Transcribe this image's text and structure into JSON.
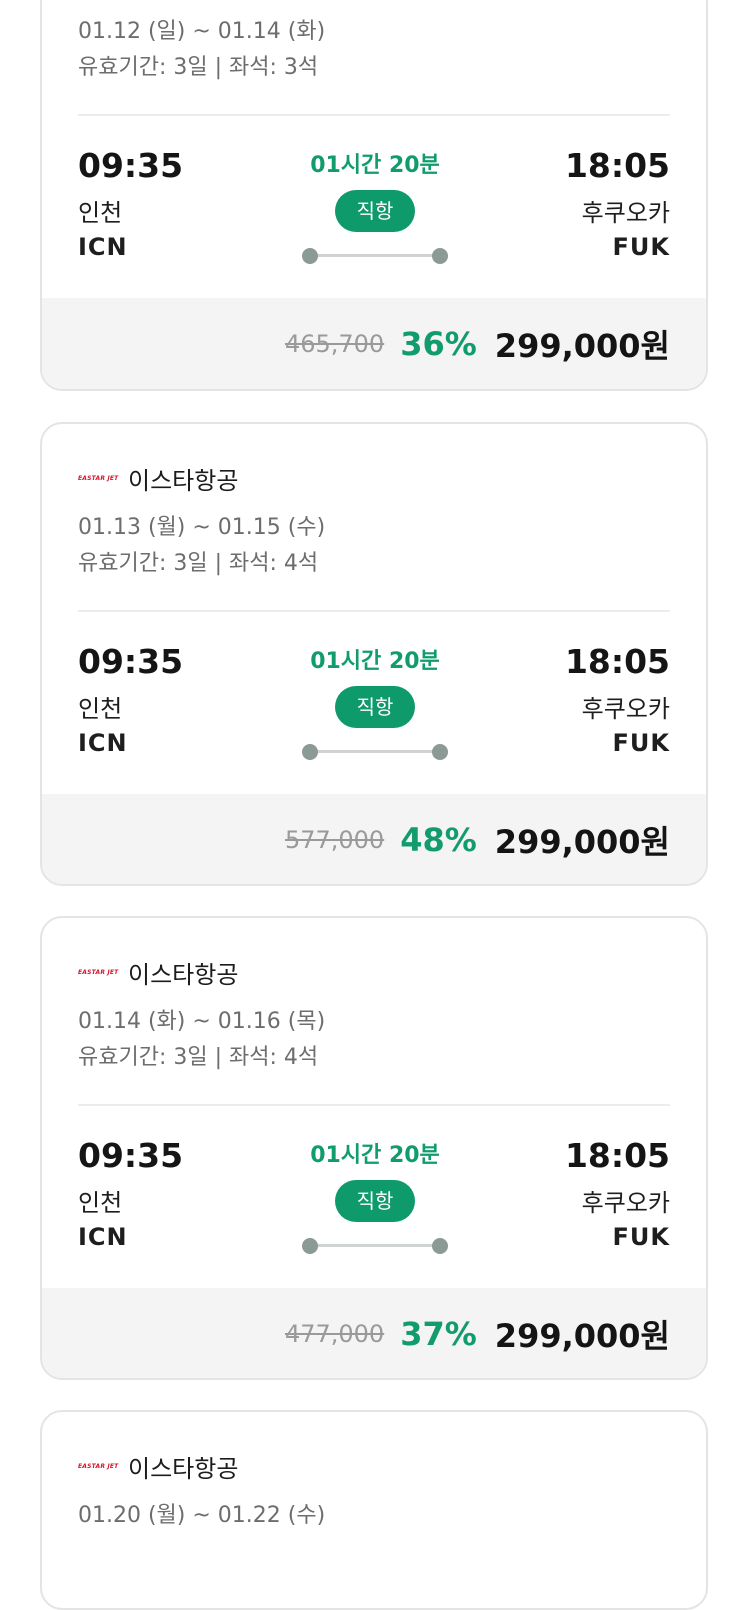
{
  "cards": [
    {
      "airline_logo": "",
      "airline_name": "",
      "dates": "01.12 (일) ~ 01.14 (화)",
      "validity": "유효기간: 3일 | 좌석: 3석",
      "departure": {
        "time": "09:35",
        "city": "인천",
        "code": "ICN"
      },
      "arrival": {
        "time": "18:05",
        "city": "후쿠오카",
        "code": "FUK"
      },
      "duration": "01시간 20분",
      "flight_type": "직항",
      "original_price": "465,700",
      "discount": "36%",
      "price": "299,000원"
    },
    {
      "airline_logo": "EASTAR JET",
      "airline_name": "이스타항공",
      "dates": "01.13 (월) ~ 01.15 (수)",
      "validity": "유효기간: 3일 | 좌석: 4석",
      "departure": {
        "time": "09:35",
        "city": "인천",
        "code": "ICN"
      },
      "arrival": {
        "time": "18:05",
        "city": "후쿠오카",
        "code": "FUK"
      },
      "duration": "01시간 20분",
      "flight_type": "직항",
      "original_price": "577,000",
      "discount": "48%",
      "price": "299,000원"
    },
    {
      "airline_logo": "EASTAR JET",
      "airline_name": "이스타항공",
      "dates": "01.14 (화) ~ 01.16 (목)",
      "validity": "유효기간: 3일 | 좌석: 4석",
      "departure": {
        "time": "09:35",
        "city": "인천",
        "code": "ICN"
      },
      "arrival": {
        "time": "18:05",
        "city": "후쿠오카",
        "code": "FUK"
      },
      "duration": "01시간 20분",
      "flight_type": "직항",
      "original_price": "477,000",
      "discount": "37%",
      "price": "299,000원"
    },
    {
      "airline_logo": "EASTAR JET",
      "airline_name": "이스타항공",
      "dates": "01.20 (월) ~ 01.22 (수)"
    }
  ],
  "colors": {
    "accent_green": "#0f9a6b",
    "airline_logo_red": "#d6152b",
    "price_bar_bg": "#f4f4f4"
  },
  "icons": {
    "route_start": "dot-icon",
    "route_end": "dot-icon"
  }
}
